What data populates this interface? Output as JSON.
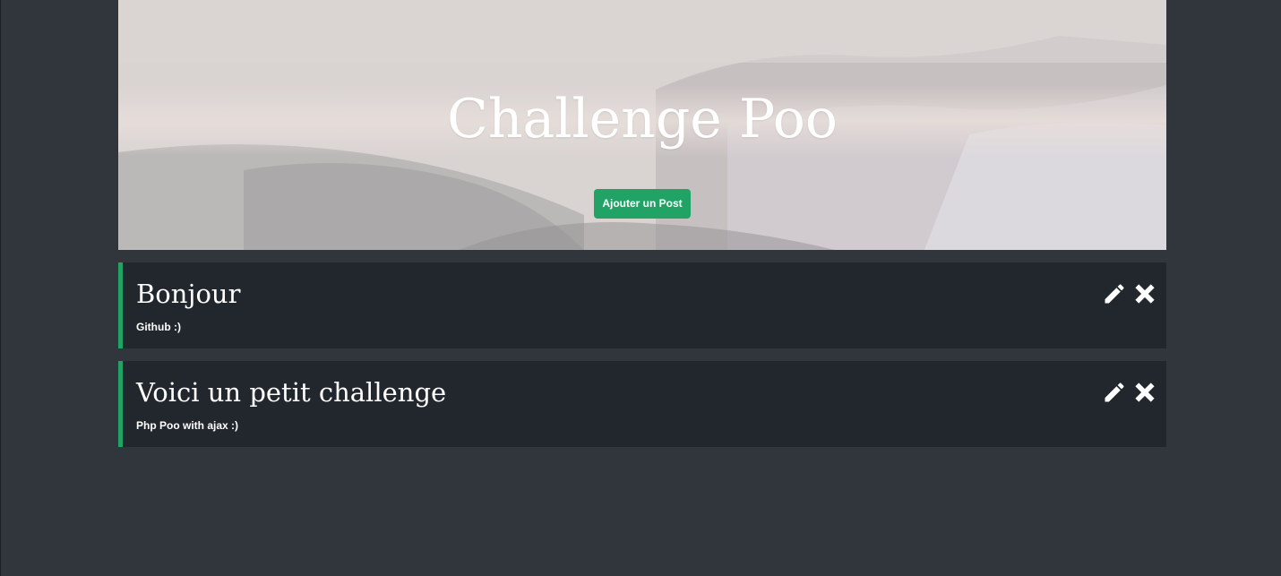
{
  "header": {
    "title": "Challenge Poo",
    "add_button_label": "Ajouter un Post"
  },
  "posts": [
    {
      "title": "Bonjour",
      "body": "Github :)"
    },
    {
      "title": "Voici un petit challenge",
      "body": "Php Poo with ajax :)"
    }
  ],
  "icons": {
    "edit": "pencil-icon",
    "delete": "close-icon"
  },
  "colors": {
    "accent": "#21a366",
    "background": "#31363d",
    "card": "#22262d"
  }
}
